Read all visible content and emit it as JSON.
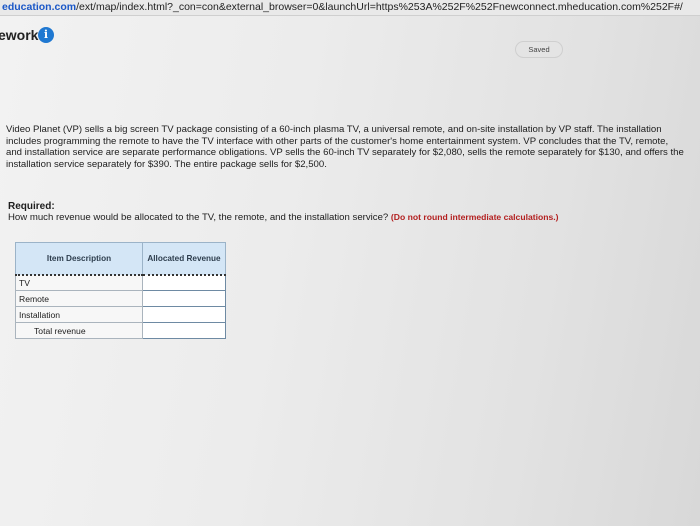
{
  "browser": {
    "url_host": "education.com",
    "url_path": "/ext/map/index.html?_con=con&external_browser=0&launchUrl=https%253A%252F%252Fnewconnect.mheducation.com%252F#/"
  },
  "header": {
    "title": "ework",
    "saved_label": "Saved"
  },
  "question": {
    "text": "Video Planet (VP) sells a big screen TV package consisting of a 60-inch plasma TV, a universal remote, and on-site installation by VP staff. The installation includes programming the remote to have the TV interface with other parts of the customer's home entertainment system. VP concludes that the TV, remote, and installation service are separate performance obligations. VP sells the 60-inch TV separately for $2,080, sells the remote separately for $130, and offers the installation service separately for $390. The entire package sells for $2,500.",
    "required_label": "Required:",
    "required_text": "How much revenue would be allocated to the TV, the remote, and the installation service?",
    "required_note": "(Do not round intermediate calculations.)"
  },
  "table": {
    "col_item": "Item Description",
    "col_revenue": "Allocated Revenue",
    "rows": [
      {
        "label": "TV",
        "value": ""
      },
      {
        "label": "Remote",
        "value": ""
      },
      {
        "label": "Installation",
        "value": ""
      },
      {
        "label": "Total revenue",
        "value": ""
      }
    ]
  },
  "colors": {
    "info_icon": "#1f78d1",
    "table_header": "#d4e6f6",
    "note": "#b32020"
  }
}
